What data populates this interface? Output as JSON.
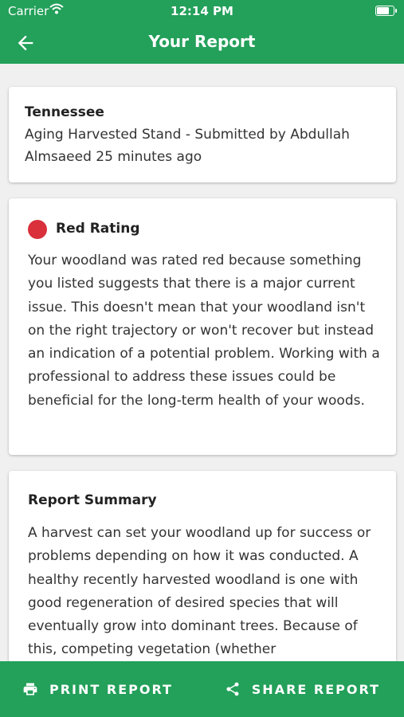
{
  "status_bar": {
    "carrier": "Carrier",
    "time": "12:14 PM"
  },
  "header": {
    "title": "Your Report",
    "back_icon": "arrow-left-icon"
  },
  "report_info": {
    "state": "Tennessee",
    "submitted": "Aging Harvested Stand - Submitted by Abdullah Almsaeed 25 minutes ago"
  },
  "rating": {
    "color": "#d9303c",
    "title": "Red Rating",
    "description": "Your woodland was rated red because something you listed suggests that there is a major current issue. This doesn't mean that your woodland isn't on the right trajectory or won't recover but instead an indication of a potential problem. Working with a professional to address these issues could be beneficial for the long-term health of your woods."
  },
  "summary": {
    "title": "Report Summary",
    "text": "A harvest can set your woodland up for success or problems depending on how it was conducted. A healthy recently harvested woodland is one with good regeneration of desired species that will eventually grow into dominant trees. Because of this, competing vegetation (whether"
  },
  "footer": {
    "print_label": "PRINT REPORT",
    "share_label": "SHARE REPORT"
  },
  "colors": {
    "brand": "#23a05a",
    "background": "#f0f0f0"
  }
}
